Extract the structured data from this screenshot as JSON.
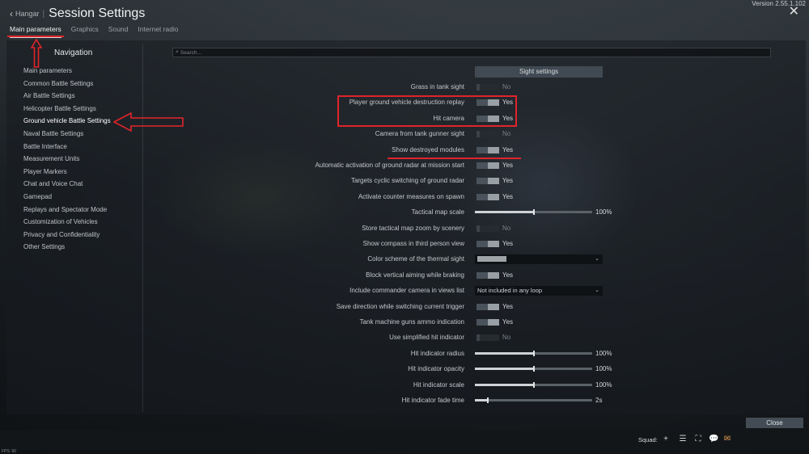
{
  "window": {
    "version": "Version 2.55.1.102",
    "back_label": "Hangar",
    "title": "Session Settings"
  },
  "tabs": [
    {
      "label": "Main parameters",
      "active": true
    },
    {
      "label": "Graphics",
      "active": false
    },
    {
      "label": "Sound",
      "active": false
    },
    {
      "label": "Internet radio",
      "active": false
    }
  ],
  "navigation": {
    "title": "Navigation",
    "items": [
      {
        "label": "Main parameters"
      },
      {
        "label": "Common Battle Settings"
      },
      {
        "label": "Air Battle Settings"
      },
      {
        "label": "Helicopter Battle Settings"
      },
      {
        "label": "Ground vehicle Battle Settings",
        "active": true
      },
      {
        "label": "Naval Battle Settings"
      },
      {
        "label": "Battle Interface"
      },
      {
        "label": "Measurement Units"
      },
      {
        "label": "Player Markers"
      },
      {
        "label": "Chat and Voice Chat"
      },
      {
        "label": "Gamepad"
      },
      {
        "label": "Replays and Spectator Mode"
      },
      {
        "label": "Customization of Vehicles"
      },
      {
        "label": "Privacy and Confidentiality"
      },
      {
        "label": "Other Settings"
      }
    ]
  },
  "search": {
    "placeholder": "Search...",
    "value": ""
  },
  "sight_settings_label": "Sight settings",
  "settings": [
    {
      "label": "Grass in tank sight",
      "type": "toggle",
      "on": false,
      "value": "No"
    },
    {
      "label": "Player ground vehicle destruction replay",
      "type": "toggle",
      "on": true,
      "value": "Yes"
    },
    {
      "label": "Hit camera",
      "type": "toggle",
      "on": true,
      "value": "Yes"
    },
    {
      "label": "Camera from tank gunner sight",
      "type": "toggle",
      "on": false,
      "value": "No"
    },
    {
      "label": "Show destroyed modules",
      "type": "toggle",
      "on": true,
      "value": "Yes"
    },
    {
      "label": "Automatic activation of ground radar at mission start",
      "type": "toggle",
      "on": true,
      "value": "Yes"
    },
    {
      "label": "Targets cyclic switching of ground radar",
      "type": "toggle",
      "on": true,
      "value": "Yes"
    },
    {
      "label": "Activate counter measures on spawn",
      "type": "toggle",
      "on": true,
      "value": "Yes"
    },
    {
      "label": "Tactical map scale",
      "type": "slider",
      "level": 0.5,
      "value": "100%"
    },
    {
      "label": "Store tactical map zoom by scenery",
      "type": "toggle",
      "on": false,
      "value": "No"
    },
    {
      "label": "Show compass in third person view",
      "type": "toggle",
      "on": true,
      "value": "Yes"
    },
    {
      "label": "Color scheme of the thermal sight",
      "type": "dropdown-swatch",
      "value": ""
    },
    {
      "label": "Block vertical aiming while braking",
      "type": "toggle",
      "on": true,
      "value": "Yes"
    },
    {
      "label": "Include commander camera in views list",
      "type": "dropdown",
      "value": "Not included in any loop"
    },
    {
      "label": "Save direction while switching current trigger",
      "type": "toggle",
      "on": true,
      "value": "Yes"
    },
    {
      "label": "Tank machine guns ammo indication",
      "type": "toggle",
      "on": true,
      "value": "Yes"
    },
    {
      "label": "Use simplified hit indicator",
      "type": "toggle",
      "on": false,
      "value": "No"
    },
    {
      "label": "Hit indicator radius",
      "type": "slider",
      "level": 0.5,
      "value": "100%"
    },
    {
      "label": "Hit indicator opacity",
      "type": "slider",
      "level": 0.5,
      "value": "100%"
    },
    {
      "label": "Hit indicator scale",
      "type": "slider",
      "level": 0.5,
      "value": "100%"
    },
    {
      "label": "Hit indicator fade time",
      "type": "slider",
      "level": 0.11,
      "value": "2s"
    }
  ],
  "close_label": "Close",
  "bottom_bar": {
    "squad_label": "Squad:",
    "fps": "FPS: 60",
    "icons": [
      "plus-icon",
      "list-icon",
      "people-icon",
      "chat-icon",
      "mail-icon"
    ]
  },
  "colors": {
    "annotation": "#e0242a",
    "mail_icon": "#e8a050"
  }
}
